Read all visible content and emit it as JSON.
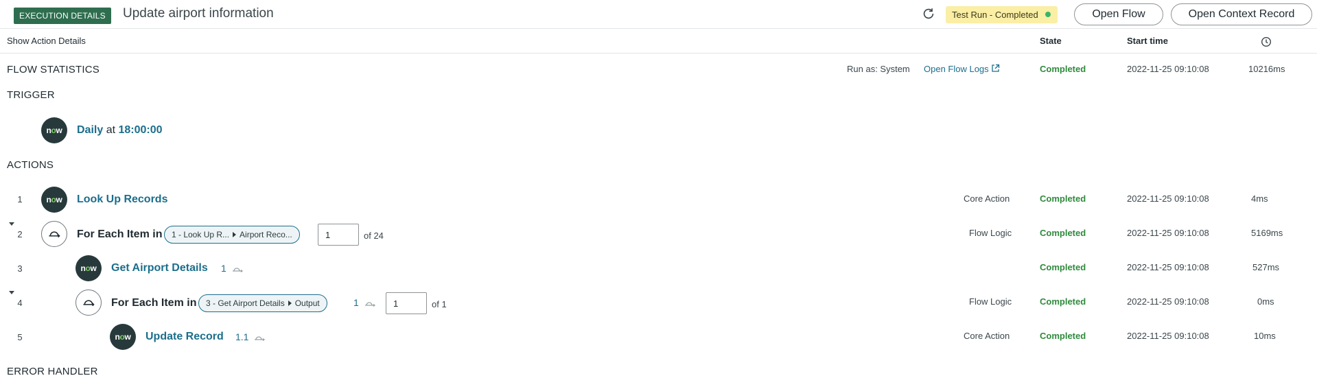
{
  "header": {
    "badge": "EXECUTION DETAILS",
    "title": "Update airport information",
    "refresh_icon": "refresh-icon",
    "status_badge": "Test Run - Completed",
    "status_dot_color": "#3ab56a",
    "open_flow": "Open Flow",
    "open_context_record": "Open Context Record"
  },
  "columns": {
    "show_action_details": "Show Action Details",
    "state": "State",
    "start_time": "Start time",
    "duration_icon": "clock-icon"
  },
  "flow_statistics": {
    "label": "FLOW STATISTICS",
    "run_as": "Run as: System",
    "open_flow_logs": "Open Flow Logs",
    "state": "Completed",
    "start_time": "2022-11-25 09:10:08",
    "duration": "10216ms"
  },
  "trigger": {
    "label": "TRIGGER",
    "icon": "now",
    "frequency": "Daily",
    "at": "at",
    "time": "18:00:00"
  },
  "actions_label": "ACTIONS",
  "actions": [
    {
      "num": "1",
      "name": "Look Up Records",
      "type": "Core Action",
      "state": "Completed",
      "start": "2022-11-25 09:10:08",
      "duration": "4ms"
    },
    {
      "num": "2",
      "name": "For Each Item in",
      "pill_left": "1 - Look Up R...",
      "pill_right": "Airport Reco...",
      "iteration": "1",
      "of": "of 24",
      "type": "Flow Logic",
      "state": "Completed",
      "start": "2022-11-25 09:10:08",
      "duration": "5169ms"
    },
    {
      "num": "3",
      "name": "Get Airport Details",
      "ref": "1",
      "type": "",
      "state": "Completed",
      "start": "2022-11-25 09:10:08",
      "duration": "527ms"
    },
    {
      "num": "4",
      "name": "For Each Item in",
      "pill_left": "3 - Get Airport Details",
      "pill_right": "Output",
      "ref": "1",
      "iteration": "1",
      "of": "of 1",
      "type": "Flow Logic",
      "state": "Completed",
      "start": "2022-11-25 09:10:08",
      "duration": "0ms"
    },
    {
      "num": "5",
      "name": "Update Record",
      "ref": "1.1",
      "type": "Core Action",
      "state": "Completed",
      "start": "2022-11-25 09:10:08",
      "duration": "10ms"
    }
  ],
  "error_handler_label": "ERROR HANDLER",
  "colors": {
    "badge_bg": "#2e6e4f",
    "status_bg": "#fbeea5",
    "link": "#1b6e8c",
    "completed": "#2f8a3d",
    "now_icon_bg": "#28393c"
  }
}
